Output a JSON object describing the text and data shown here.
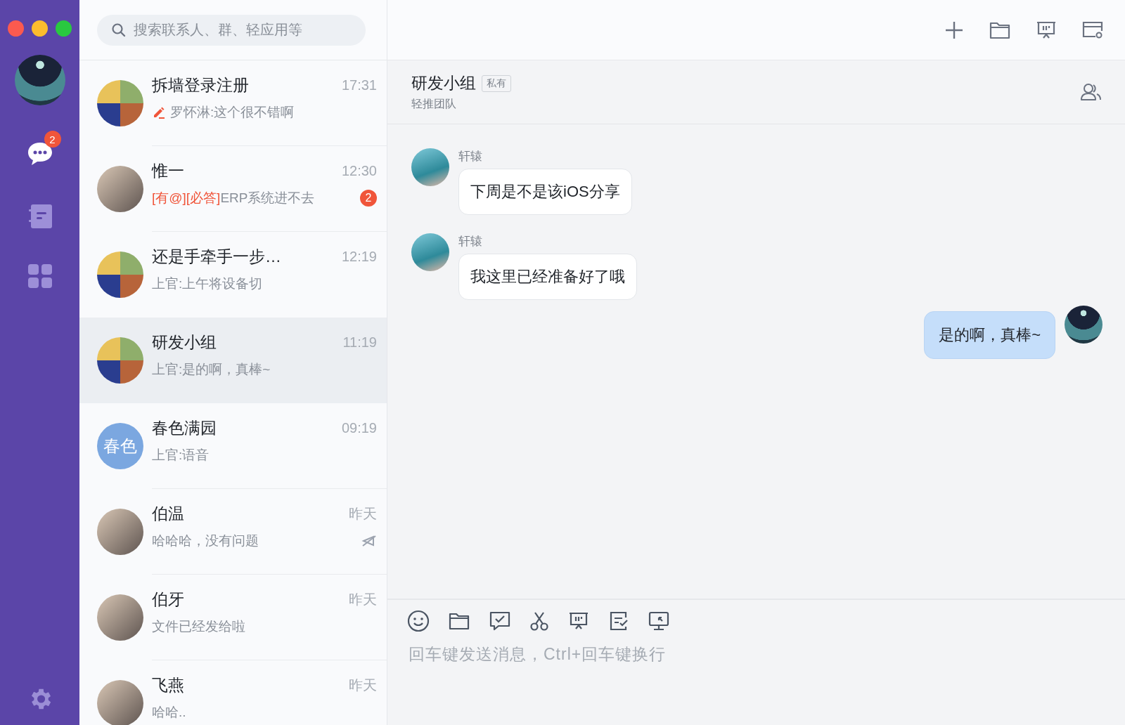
{
  "nav": [
    {
      "kind": "chat",
      "selected": true,
      "badge": "2"
    },
    {
      "kind": "contacts",
      "selected": false
    },
    {
      "kind": "apps",
      "selected": false
    }
  ],
  "search": {
    "placeholder": "搜索联系人、群、轻应用等"
  },
  "conversations": [
    {
      "name": "拆墙登录注册",
      "time": "17:31",
      "preview": "罗怀淋:这个很不错啊",
      "draft": true,
      "avatar": {
        "kind": "group"
      },
      "selected": false,
      "muted": false
    },
    {
      "name": "惟一",
      "time": "12:30",
      "mention": "[有@][必答]",
      "preview": "ERP系统进不去",
      "draft": false,
      "avatar": {
        "kind": "photo"
      },
      "badge": "2",
      "selected": false,
      "muted": false
    },
    {
      "name": "还是手牵手一步…",
      "time": "12:19",
      "preview": "上官:上午将设备切",
      "draft": false,
      "avatar": {
        "kind": "group"
      },
      "selected": false,
      "muted": false
    },
    {
      "name": "研发小组",
      "time": "11:19",
      "preview": "上官:是的啊，真棒~",
      "draft": false,
      "avatar": {
        "kind": "group"
      },
      "selected": true,
      "muted": false
    },
    {
      "name": "春色满园",
      "time": "09:19",
      "preview": "上官:语音",
      "draft": false,
      "avatar": {
        "kind": "text",
        "text": "春色",
        "color": "#7ba7e0"
      },
      "selected": false,
      "muted": false
    },
    {
      "name": "伯温",
      "time": "昨天",
      "preview": "哈哈哈，没有问题",
      "draft": false,
      "avatar": {
        "kind": "photo"
      },
      "selected": false,
      "muted": true
    },
    {
      "name": "伯牙",
      "time": "昨天",
      "preview": "文件已经发给啦",
      "draft": false,
      "avatar": {
        "kind": "photo"
      },
      "selected": false,
      "muted": false
    },
    {
      "name": "飞燕",
      "time": "昨天",
      "preview": "哈哈..",
      "draft": false,
      "avatar": {
        "kind": "photo"
      },
      "selected": false,
      "muted": false
    }
  ],
  "chat": {
    "title": "研发小组",
    "tag": "私有",
    "subtitle": "轻推团队",
    "messages": [
      {
        "sender": "轩辕",
        "text": "下周是不是该iOS分享",
        "own": false
      },
      {
        "sender": "轩辕",
        "text": "我这里已经准备好了哦",
        "own": false
      },
      {
        "text": "是的啊，真棒~",
        "own": true
      }
    ],
    "input": {
      "placeholder": "回车键发送消息，Ctrl+回车键换行"
    }
  }
}
